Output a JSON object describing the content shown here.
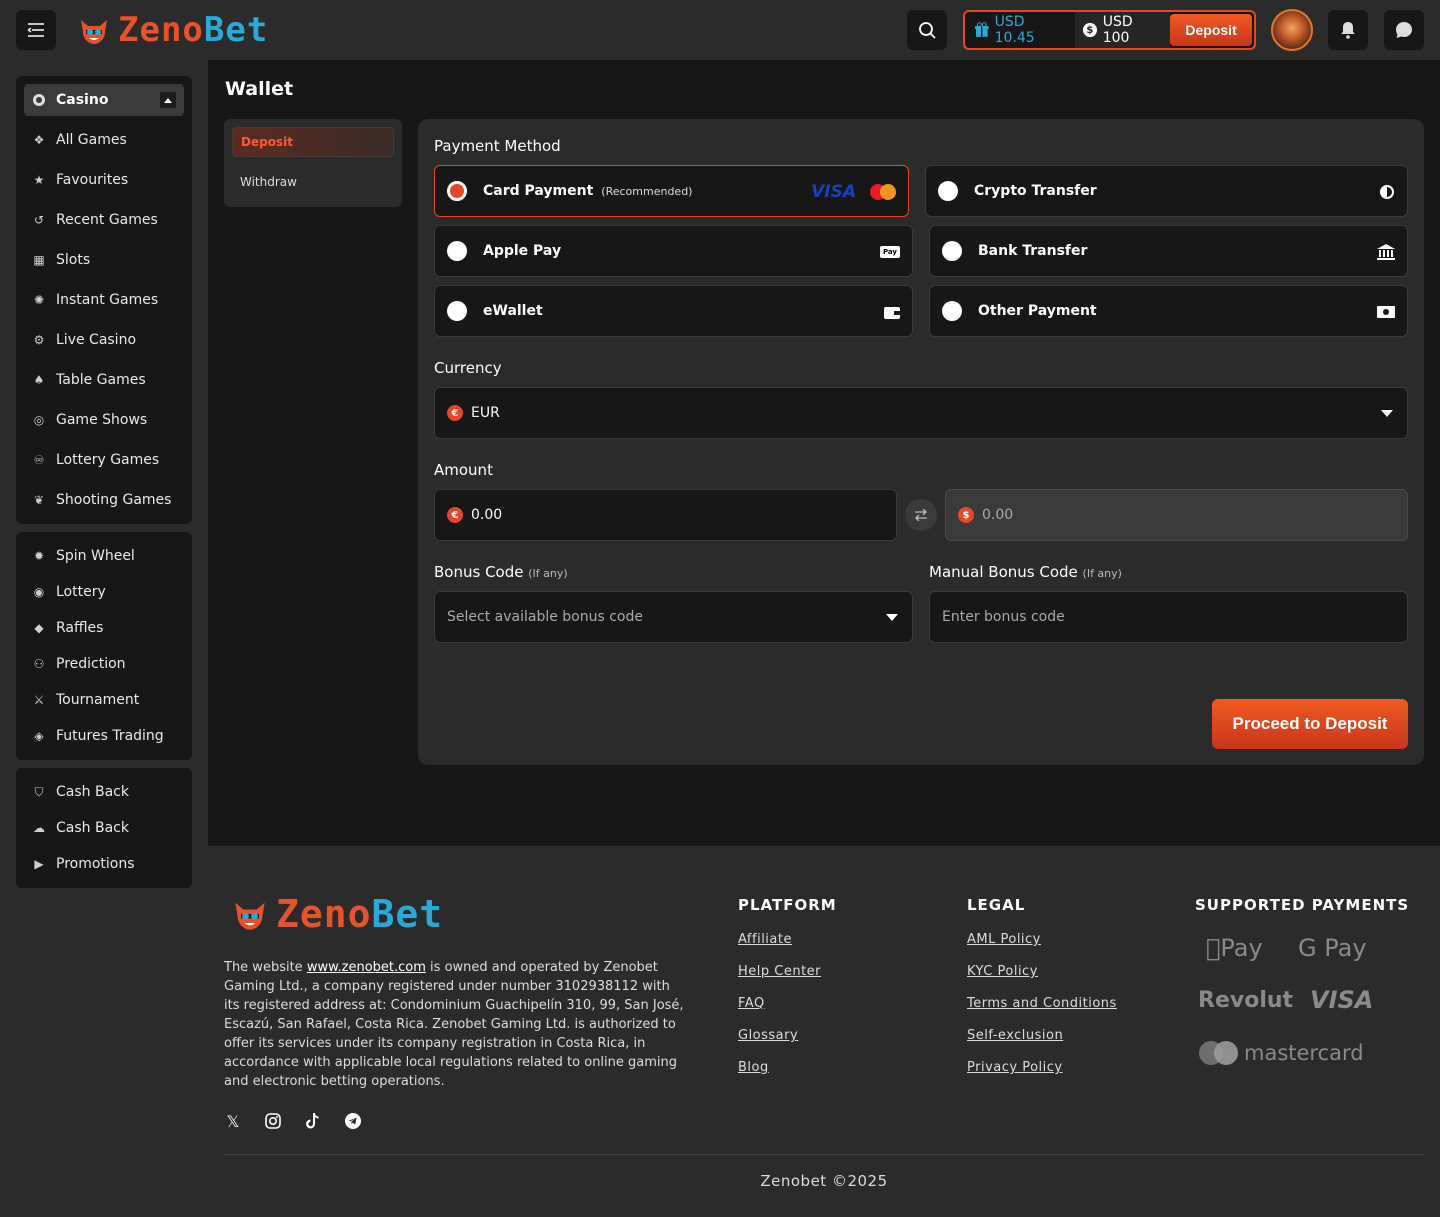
{
  "header": {
    "brand_part1": "Zeno",
    "brand_part2": "Bet",
    "bonus_balance": "USD 10.45",
    "cash_balance": "USD 100",
    "coin_symbol": "$",
    "deposit_label": "Deposit"
  },
  "sidebar": {
    "casino_label": "Casino",
    "group1": [
      {
        "label": "All Games",
        "icon": "all-games-icon"
      },
      {
        "label": "Favourites",
        "icon": "star-icon"
      },
      {
        "label": "Recent Games",
        "icon": "history-icon"
      },
      {
        "label": "Slots",
        "icon": "slots-icon"
      },
      {
        "label": "Instant Games",
        "icon": "instant-icon"
      },
      {
        "label": "Live Casino",
        "icon": "live-casino-icon"
      },
      {
        "label": "Table Games",
        "icon": "cards-icon"
      },
      {
        "label": "Game Shows",
        "icon": "game-shows-icon"
      },
      {
        "label": "Lottery Games",
        "icon": "lottery-games-icon"
      },
      {
        "label": "Shooting Games",
        "icon": "shooting-icon"
      }
    ],
    "group2": [
      {
        "label": "Spin Wheel",
        "icon": "spin-wheel-icon"
      },
      {
        "label": "Lottery",
        "icon": "lottery-icon"
      },
      {
        "label": "Raffles",
        "icon": "ticket-icon"
      },
      {
        "label": "Prediction",
        "icon": "prediction-icon"
      },
      {
        "label": "Tournament",
        "icon": "tournament-icon"
      },
      {
        "label": "Futures Trading",
        "icon": "eye-icon"
      }
    ],
    "group3": [
      {
        "label": "Cash Back",
        "icon": "cashback-icon"
      },
      {
        "label": "Cash Back",
        "icon": "coins-icon"
      },
      {
        "label": "Promotions",
        "icon": "megaphone-icon"
      }
    ]
  },
  "wallet": {
    "title": "Wallet",
    "tabs": {
      "deposit": "Deposit",
      "withdraw": "Withdraw"
    },
    "payment_method_label": "Payment Method",
    "methods": {
      "card": {
        "label": "Card Payment",
        "note": "(Recommended)",
        "visa": "VISA"
      },
      "crypto": {
        "label": "Crypto Transfer"
      },
      "apple": {
        "label": "Apple Pay",
        "badge": "Pay"
      },
      "bank": {
        "label": "Bank Transfer"
      },
      "ewallet": {
        "label": "eWallet"
      },
      "other": {
        "label": "Other Payment"
      }
    },
    "currency_label": "Currency",
    "currency_value": "EUR",
    "currency_symbol": "€",
    "usd_symbol": "$",
    "amount_label": "Amount",
    "amount_eur": "0.00",
    "amount_usd": "0.00",
    "bonus_code_label": "Bonus Code",
    "bonus_code_note": "(If any)",
    "bonus_code_placeholder": "Select available bonus code",
    "manual_bonus_label": "Manual Bonus Code",
    "manual_bonus_note": "(If any)",
    "manual_bonus_placeholder": "Enter bonus code",
    "proceed_label": "Proceed to Deposit"
  },
  "footer": {
    "desc_pre": "The website ",
    "desc_link": "www.zenobet.com",
    "desc_post": " is owned and operated by Zenobet Gaming Ltd., a company registered under number 3102938112 with its registered address at: Condominium Guachipelín 310, 99, San José, Escazú, San Rafael, Costa Rica. Zenobet Gaming Ltd. is authorized to offer its services under its company registration in Costa Rica, in accordance with applicable local regulations related to online gaming and electronic betting operations.",
    "platform_title": "PLATFORM",
    "platform_links": [
      "Affiliate",
      "Help Center",
      "FAQ",
      "Glossary",
      "Blog"
    ],
    "legal_title": "LEGAL",
    "legal_links": [
      "AML Policy",
      "KYC Policy",
      "Terms and Conditions",
      "Self-exclusion",
      "Privacy Policy"
    ],
    "payments_title": "SUPPORTED PAYMENTS",
    "payments": [
      "Pay",
      "G Pay",
      "Revolut",
      "VISA",
      "mastercard"
    ],
    "copyright": "Zenobet ©2025"
  },
  "colors": {
    "accent": "#e34a22",
    "brand_blue": "#2aa9d8",
    "bg": "#171717",
    "panel": "#2b2b2b"
  }
}
